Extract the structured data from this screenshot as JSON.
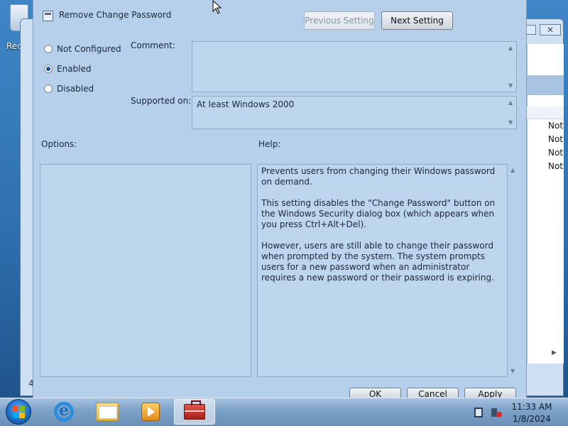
{
  "desktop": {
    "recycle_label": "Recy"
  },
  "background_window": {
    "close_glyph": "✕",
    "rows": [
      "Not",
      "Not",
      "Not",
      "Not"
    ],
    "left_mark": "4"
  },
  "dialog": {
    "title": "Remove Change Password",
    "previous_setting": "Previous Setting",
    "next_setting": "Next Setting",
    "options_state": {
      "not_configured": "Not Configured",
      "enabled": "Enabled",
      "disabled": "Disabled",
      "selected": "enabled"
    },
    "comment_label": "Comment:",
    "comment_value": "",
    "supported_label": "Supported on:",
    "supported_value": "At least Windows 2000",
    "options_label": "Options:",
    "help_label": "Help:",
    "help": {
      "p1": "Prevents users from changing their Windows password on demand.",
      "p2": "This setting disables the \"Change Password\" button on the Windows Security dialog box (which appears when you press Ctrl+Alt+Del).",
      "p3": "However, users are still able to change their password when prompted by the system. The system prompts users for a new password when an administrator requires a new password or their password is expiring."
    },
    "ok": "OK",
    "cancel": "Cancel",
    "apply": "Apply"
  },
  "taskbar": {
    "apps": [
      "internet-explorer-icon",
      "windows-explorer-icon",
      "media-player-icon",
      "group-policy-editor-icon"
    ],
    "active_app": "group-policy-editor-icon",
    "time": "11:33 AM",
    "date": "1/8/2024"
  },
  "colors": {
    "dialog_bg": "#b6d0ec",
    "field_bg": "#bed5ee",
    "taskbar": "#7ea3c9",
    "desktop": "#2e6fae"
  }
}
